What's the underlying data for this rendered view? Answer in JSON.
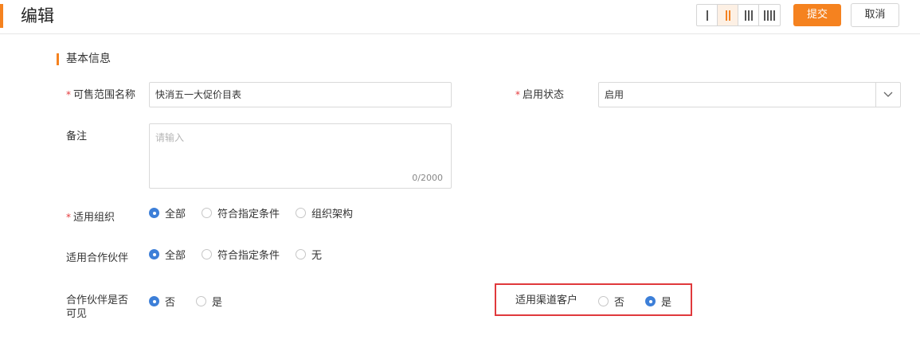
{
  "header": {
    "title": "编辑",
    "column_options": [
      "1-column",
      "2-column",
      "3-column",
      "4-column"
    ],
    "selected_column_option": "2-column",
    "submit_label": "提交",
    "cancel_label": "取消",
    "accent_color": "#f5821f"
  },
  "section": {
    "title": "基本信息"
  },
  "form": {
    "name": {
      "label": "可售范围名称",
      "required_mark": "*",
      "value": "快消五一大促价目表"
    },
    "status": {
      "label": "启用状态",
      "required_mark": "*",
      "value": "启用",
      "icon": "chevron-down-icon"
    },
    "remark": {
      "label": "备注",
      "placeholder": "请输入",
      "counter": "0/2000"
    },
    "org": {
      "label": "适用组织",
      "required_mark": "*",
      "options": [
        "全部",
        "符合指定条件",
        "组织架构"
      ],
      "selected": "全部"
    },
    "partner": {
      "label": "适用合作伙伴",
      "options": [
        "全部",
        "符合指定条件",
        "无"
      ],
      "selected": "全部"
    },
    "partner_visible": {
      "label_line1": "合作伙伴是否",
      "label_line2": "可见",
      "options": [
        "否",
        "是"
      ],
      "selected": "否"
    },
    "channel": {
      "label": "适用渠道客户",
      "options": [
        "否",
        "是"
      ],
      "selected": "是"
    }
  },
  "colors": {
    "radio_checked": "#3d7fd8",
    "required": "#e4393c",
    "highlight_border": "#e0393c"
  }
}
